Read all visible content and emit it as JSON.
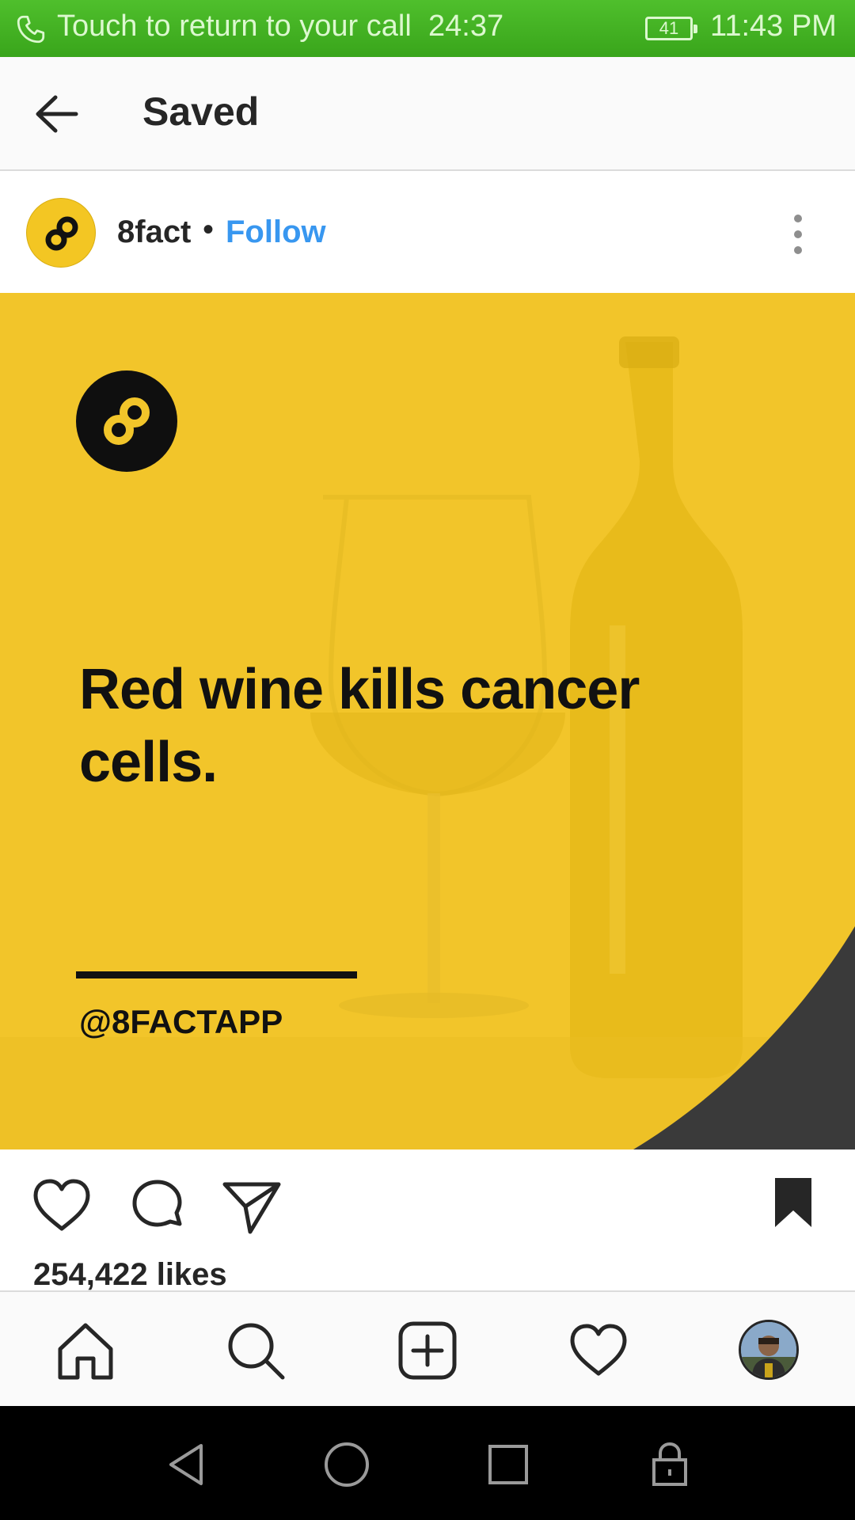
{
  "status_bar": {
    "call_text": "Touch to return to your call",
    "call_timer": "24:37",
    "battery": "41",
    "time": "11:43 PM"
  },
  "header": {
    "title": "Saved"
  },
  "post": {
    "username": "8fact",
    "separator": "•",
    "follow_label": "Follow",
    "headline": "Red wine kills cancer cells.",
    "handle": "@8FACTAPP",
    "likes": "254,422 likes"
  },
  "colors": {
    "status_green": "#3aa61c",
    "brand_yellow": "#f2c52a",
    "link_blue": "#3897f0"
  },
  "icons": {
    "back": "arrow-left-icon",
    "more": "vertical-dots-icon",
    "like": "heart-outline-icon",
    "comment": "comment-bubble-icon",
    "share": "paper-plane-icon",
    "save": "bookmark-filled-icon",
    "nav": [
      "home-icon",
      "search-icon",
      "add-post-icon",
      "activity-heart-icon",
      "profile-avatar"
    ],
    "system": [
      "back-triangle-icon",
      "home-circle-icon",
      "recents-square-icon",
      "lock-icon"
    ]
  }
}
